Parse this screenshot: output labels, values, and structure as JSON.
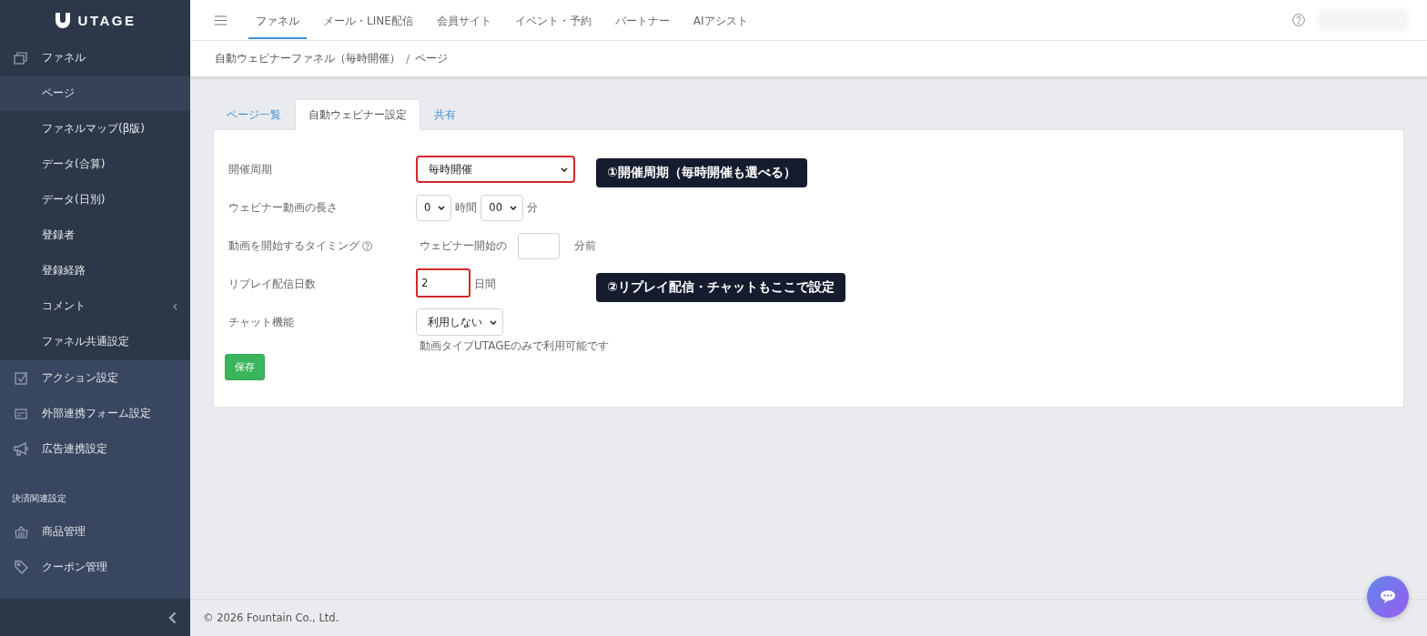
{
  "logo": {
    "text": "UTAGE"
  },
  "top_nav": {
    "items": [
      {
        "label": "ファネル",
        "selected": true
      },
      {
        "label": "メール・LINE配信",
        "selected": false
      },
      {
        "label": "会員サイト",
        "selected": false
      },
      {
        "label": "イベント・予約",
        "selected": false
      },
      {
        "label": "パートナー",
        "selected": false
      },
      {
        "label": "AIアシスト",
        "selected": false
      }
    ]
  },
  "breadcrumb": {
    "separator": "/",
    "items": [
      "自動ウェビナーファネル（毎時開催）",
      "ページ"
    ]
  },
  "sidebar": {
    "items": [
      {
        "kind": "link",
        "label": "ファネル",
        "expanded": true,
        "children": [
          {
            "label": "ページ",
            "selected": true,
            "collapsible": false
          },
          {
            "label": "ファネルマップ(β版)",
            "selected": false,
            "collapsible": false
          },
          {
            "label": "データ(合算)",
            "selected": false,
            "collapsible": false
          },
          {
            "label": "データ(日別)",
            "selected": false,
            "collapsible": false
          },
          {
            "label": "登録者",
            "selected": false,
            "collapsible": false
          },
          {
            "label": "登録経路",
            "selected": false,
            "collapsible": false
          },
          {
            "label": "コメント",
            "selected": false,
            "collapsible": true
          },
          {
            "label": "ファネル共通設定",
            "selected": false,
            "collapsible": false
          }
        ]
      },
      {
        "kind": "link",
        "label": "アクション設定"
      },
      {
        "kind": "link",
        "label": "外部連携フォーム設定"
      },
      {
        "kind": "link",
        "label": "広告連携設定"
      },
      {
        "kind": "heading",
        "label": "決済関連設定"
      },
      {
        "kind": "link",
        "label": "商品管理"
      },
      {
        "kind": "link",
        "label": "クーポン管理"
      }
    ]
  },
  "tabs": [
    {
      "label": "ページ一覧",
      "selected": false
    },
    {
      "label": "自動ウェビナー設定",
      "selected": true
    },
    {
      "label": "共有",
      "selected": false
    }
  ],
  "form": {
    "rows": [
      {
        "kind": "select",
        "label": "開催周期",
        "value": "毎時開催",
        "highlighted": true,
        "callout": "①開催周期（毎時開催も選べる）"
      },
      {
        "kind": "duration",
        "label": "ウェビナー動画の長さ",
        "hours": "0",
        "hours_unit": "時間",
        "minutes": "00",
        "minutes_unit": "分"
      },
      {
        "kind": "offset",
        "label": "動画を開始するタイミング",
        "help": true,
        "prefix": "ウェビナー開始の",
        "suffix": "分前"
      },
      {
        "kind": "number",
        "label": "リプレイ配信日数",
        "value": "2",
        "suffix": "日間",
        "highlighted": true,
        "callout": "②リプレイ配信・チャットもここで設定"
      },
      {
        "kind": "select",
        "label": "チャット機能",
        "value": "利用しない",
        "highlighted": false,
        "note": "動画タイプUTAGEのみで利用可能です"
      }
    ],
    "save": "保存"
  },
  "footer": "© 2026 Fountain Co., Ltd."
}
